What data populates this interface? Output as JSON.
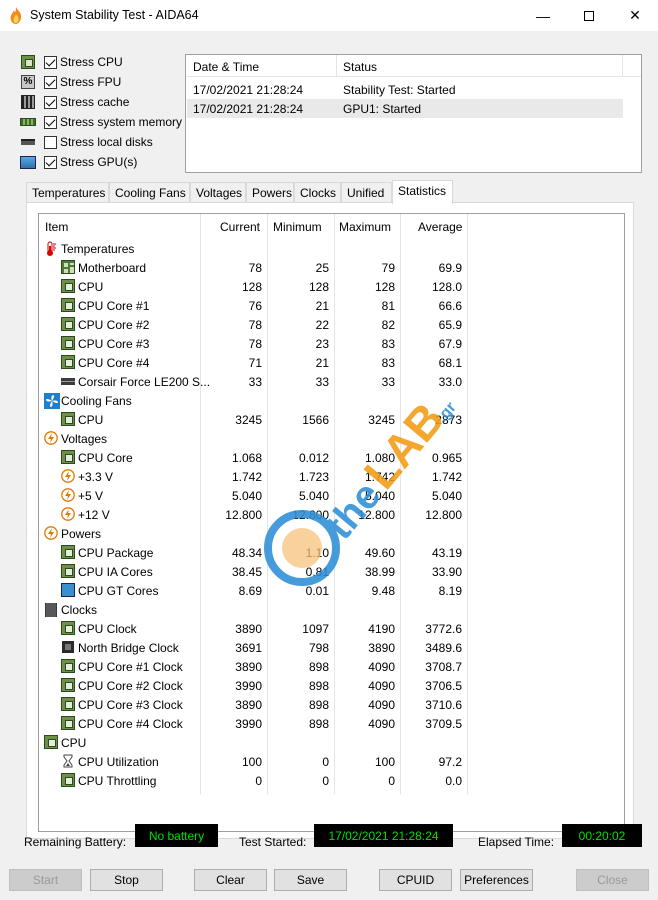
{
  "window": {
    "title": "System Stability Test - AIDA64",
    "minimize": "—",
    "close": "✕"
  },
  "stress_options": [
    {
      "label": "Stress CPU",
      "checked": true,
      "icon": "cpu-chip-icon"
    },
    {
      "label": "Stress FPU",
      "checked": true,
      "icon": "fpu-icon"
    },
    {
      "label": "Stress cache",
      "checked": true,
      "icon": "cache-icon"
    },
    {
      "label": "Stress system memory",
      "checked": true,
      "icon": "memory-icon"
    },
    {
      "label": "Stress local disks",
      "checked": false,
      "icon": "disk-icon"
    },
    {
      "label": "Stress GPU(s)",
      "checked": true,
      "icon": "gpu-monitor-icon"
    }
  ],
  "log": {
    "headers": {
      "datetime": "Date & Time",
      "status": "Status"
    },
    "rows": [
      {
        "datetime": "17/02/2021 21:28:24",
        "status": "Stability Test: Started"
      },
      {
        "datetime": "17/02/2021 21:28:24",
        "status": "GPU1: Started"
      }
    ]
  },
  "tabs": [
    "Temperatures",
    "Cooling Fans",
    "Voltages",
    "Powers",
    "Clocks",
    "Unified",
    "Statistics"
  ],
  "active_tab": "Statistics",
  "stats": {
    "headers": {
      "item": "Item",
      "current": "Current",
      "minimum": "Minimum",
      "maximum": "Maximum",
      "average": "Average"
    },
    "rows": [
      {
        "type": "group",
        "name": "Temperatures",
        "icon": "thermometer-icon"
      },
      {
        "type": "item",
        "name": "Motherboard",
        "icon": "motherboard-icon",
        "current": "78",
        "minimum": "25",
        "maximum": "79",
        "average": "69.9"
      },
      {
        "type": "item",
        "name": "CPU",
        "icon": "cpu-chip-icon",
        "current": "128",
        "minimum": "128",
        "maximum": "128",
        "average": "128.0"
      },
      {
        "type": "item",
        "name": "CPU Core #1",
        "icon": "cpu-chip-icon",
        "current": "76",
        "minimum": "21",
        "maximum": "81",
        "average": "66.6"
      },
      {
        "type": "item",
        "name": "CPU Core #2",
        "icon": "cpu-chip-icon",
        "current": "78",
        "minimum": "22",
        "maximum": "82",
        "average": "65.9"
      },
      {
        "type": "item",
        "name": "CPU Core #3",
        "icon": "cpu-chip-icon",
        "current": "78",
        "minimum": "23",
        "maximum": "83",
        "average": "67.9"
      },
      {
        "type": "item",
        "name": "CPU Core #4",
        "icon": "cpu-chip-icon",
        "current": "71",
        "minimum": "21",
        "maximum": "83",
        "average": "68.1"
      },
      {
        "type": "item",
        "name": "Corsair Force LE200 S...",
        "icon": "disk-icon",
        "current": "33",
        "minimum": "33",
        "maximum": "33",
        "average": "33.0"
      },
      {
        "type": "group",
        "name": "Cooling Fans",
        "icon": "fan-icon"
      },
      {
        "type": "item",
        "name": "CPU",
        "icon": "cpu-chip-icon",
        "current": "3245",
        "minimum": "1566",
        "maximum": "3245",
        "average": "2873"
      },
      {
        "type": "group",
        "name": "Voltages",
        "icon": "lightning-icon"
      },
      {
        "type": "item",
        "name": "CPU Core",
        "icon": "cpu-chip-icon",
        "current": "1.068",
        "minimum": "0.012",
        "maximum": "1.080",
        "average": "0.965"
      },
      {
        "type": "item",
        "name": "+3.3 V",
        "icon": "lightning-icon",
        "current": "1.742",
        "minimum": "1.723",
        "maximum": "1.742",
        "average": "1.742"
      },
      {
        "type": "item",
        "name": "+5 V",
        "icon": "lightning-icon",
        "current": "5.040",
        "minimum": "5.040",
        "maximum": "5.040",
        "average": "5.040"
      },
      {
        "type": "item",
        "name": "+12 V",
        "icon": "lightning-icon",
        "current": "12.800",
        "minimum": "12.800",
        "maximum": "12.800",
        "average": "12.800"
      },
      {
        "type": "group",
        "name": "Powers",
        "icon": "lightning-icon"
      },
      {
        "type": "item",
        "name": "CPU Package",
        "icon": "cpu-chip-icon",
        "current": "48.34",
        "minimum": "1.10",
        "maximum": "49.60",
        "average": "43.19"
      },
      {
        "type": "item",
        "name": "CPU IA Cores",
        "icon": "cpu-chip-icon",
        "current": "38.45",
        "minimum": "0.81",
        "maximum": "38.99",
        "average": "33.90"
      },
      {
        "type": "item",
        "name": "CPU GT Cores",
        "icon": "gpu-monitor-icon",
        "current": "8.69",
        "minimum": "0.01",
        "maximum": "9.48",
        "average": "8.19"
      },
      {
        "type": "group",
        "name": "Clocks",
        "icon": "clock-icon"
      },
      {
        "type": "item",
        "name": "CPU Clock",
        "icon": "cpu-chip-icon",
        "current": "3890",
        "minimum": "1097",
        "maximum": "4190",
        "average": "3772.6"
      },
      {
        "type": "item",
        "name": "North Bridge Clock",
        "icon": "northbridge-icon",
        "current": "3691",
        "minimum": "798",
        "maximum": "3890",
        "average": "3489.6"
      },
      {
        "type": "item",
        "name": "CPU Core #1 Clock",
        "icon": "cpu-chip-icon",
        "current": "3890",
        "minimum": "898",
        "maximum": "4090",
        "average": "3708.7"
      },
      {
        "type": "item",
        "name": "CPU Core #2 Clock",
        "icon": "cpu-chip-icon",
        "current": "3990",
        "minimum": "898",
        "maximum": "4090",
        "average": "3706.5"
      },
      {
        "type": "item",
        "name": "CPU Core #3 Clock",
        "icon": "cpu-chip-icon",
        "current": "3890",
        "minimum": "898",
        "maximum": "4090",
        "average": "3710.6"
      },
      {
        "type": "item",
        "name": "CPU Core #4 Clock",
        "icon": "cpu-chip-icon",
        "current": "3990",
        "minimum": "898",
        "maximum": "4090",
        "average": "3709.5"
      },
      {
        "type": "group",
        "name": "CPU",
        "icon": "cpu-chip-icon"
      },
      {
        "type": "item",
        "name": "CPU Utilization",
        "icon": "hourglass-icon",
        "current": "100",
        "minimum": "0",
        "maximum": "100",
        "average": "97.2"
      },
      {
        "type": "item",
        "name": "CPU Throttling",
        "icon": "cpu-chip-icon",
        "current": "0",
        "minimum": "0",
        "maximum": "0",
        "average": "0.0"
      }
    ]
  },
  "status_bar": {
    "battery_label": "Remaining Battery:",
    "battery_value": "No battery",
    "started_label": "Test Started:",
    "started_value": "17/02/2021 21:28:24",
    "elapsed_label": "Elapsed Time:",
    "elapsed_value": "00:20:02"
  },
  "buttons": {
    "start": "Start",
    "stop": "Stop",
    "clear": "Clear",
    "save": "Save",
    "cpuid": "CPUID",
    "preferences": "Preferences",
    "close": "Close"
  },
  "watermark": {
    "text_the": "the",
    "text_lab": "LAB",
    "text_gr": ".gr"
  },
  "colors": {
    "display_bg": "#000000",
    "display_fg": "#00e000",
    "watermark_blue": "#2d8fd6",
    "watermark_orange": "#f39c12"
  }
}
